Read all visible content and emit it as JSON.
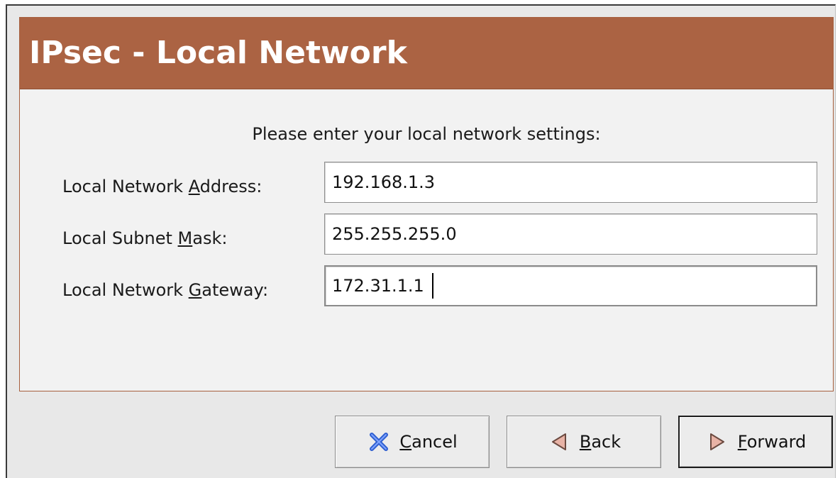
{
  "header": {
    "title": "IPsec - Local Network"
  },
  "form": {
    "instruction": "Please enter your local network settings:",
    "fields": [
      {
        "label_pre": "Local Network ",
        "label_mnemonic": "A",
        "label_post": "ddress:",
        "value": "192.168.1.3"
      },
      {
        "label_pre": "Local Subnet ",
        "label_mnemonic": "M",
        "label_post": "ask:",
        "value": "255.255.255.0"
      },
      {
        "label_pre": "Local Network ",
        "label_mnemonic": "G",
        "label_post": "ateway:",
        "value": "172.31.1.1"
      }
    ]
  },
  "buttons": {
    "cancel": {
      "mnemonic": "C",
      "rest": "ancel",
      "icon": "cancel-x-icon"
    },
    "back": {
      "mnemonic": "B",
      "rest": "ack",
      "icon": "back-arrow-icon"
    },
    "forward": {
      "mnemonic": "F",
      "rest": "orward",
      "icon": "forward-arrow-icon"
    }
  },
  "colors": {
    "header_bg": "#ab6343",
    "page_border": "#a65f3e",
    "cancel_icon": "#2f5fd0"
  }
}
